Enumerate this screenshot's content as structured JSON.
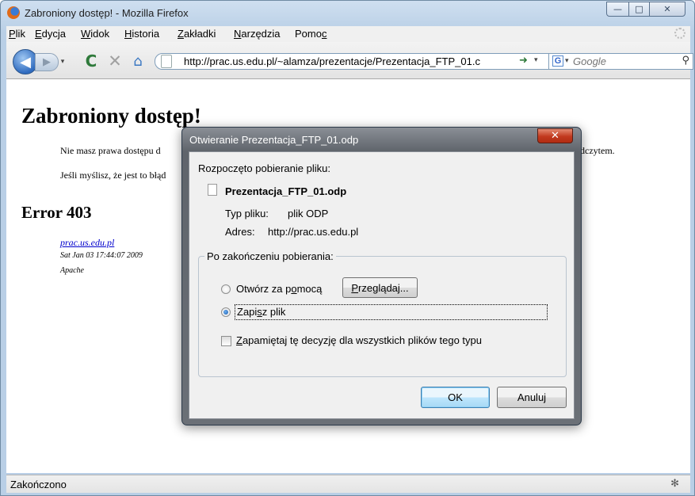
{
  "window": {
    "title": "Zabroniony dostęp! - Mozilla Firefox",
    "controls": {
      "minimize": "—",
      "maximize": "□",
      "close": "✕"
    }
  },
  "menu": [
    {
      "label": "Plik",
      "key": "P",
      "rest": "lik"
    },
    {
      "label": "Edycja",
      "key": "E",
      "rest": "dycja"
    },
    {
      "label": "Widok",
      "key": "W",
      "rest": "idok"
    },
    {
      "label": "Historia",
      "key": "H",
      "rest": "istoria"
    },
    {
      "label": "Zakładki",
      "key": "Z",
      "rest": "akładki"
    },
    {
      "label": "Narzędzia",
      "key": "N",
      "rest": "arzędzia"
    },
    {
      "label": "Pomoc",
      "pre": "Pomo",
      "key": "c"
    }
  ],
  "navbar": {
    "url": "http://prac.us.edu.pl/~alamza/prezentacje/Prezentacja_FTP_01.c",
    "search_placeholder": "Google",
    "search_engine_letter": "G",
    "icons": {
      "back": "◀",
      "forward": "▶",
      "history": "▾",
      "reload": "C",
      "stop": "✕",
      "home": "⌂",
      "go": "➜",
      "dropdown": "▾",
      "search": "⚲"
    }
  },
  "page": {
    "title": "Zabroniony dostęp!",
    "paragraph1_start": "Nie masz prawa dostępu d",
    "paragraph1_end": "dczytem.",
    "paragraph2_start": "Jeśli myślisz, że jest to błąd",
    "error_title": "Error 403",
    "address_link": "prac.us.edu.pl",
    "address_date": "Sat Jan 03 17:44:07 2009",
    "address_server": "Apache"
  },
  "status": {
    "text": "Zakończono",
    "icon": "✻"
  },
  "dialog": {
    "title": "Otwieranie Prezentacja_FTP_01.odp",
    "close_symbol": "✕",
    "intro": "Rozpoczęto pobieranie pliku:",
    "file_name": "Prezentacja_FTP_01.odp",
    "file_type_label": "Typ pliku:",
    "file_type_value": "plik ODP",
    "address_label": "Adres:",
    "address_value": "http://prac.us.edu.pl",
    "group_label": "Po zakończeniu pobierania:",
    "open_with": {
      "pre": "Otwórz za p",
      "key": "o",
      "post": "mocą"
    },
    "browse": {
      "key": "P",
      "post": "rzeglądaj..."
    },
    "save": {
      "pre": "Zapi",
      "key": "s",
      "post": "z plik"
    },
    "remember": {
      "key": "Z",
      "post": "apamiętaj tę decyzję dla wszystkich plików tego typu"
    },
    "ok": "OK",
    "cancel": "Anuluj",
    "selected_option": "Zapisz plik",
    "remember_checked": false
  }
}
